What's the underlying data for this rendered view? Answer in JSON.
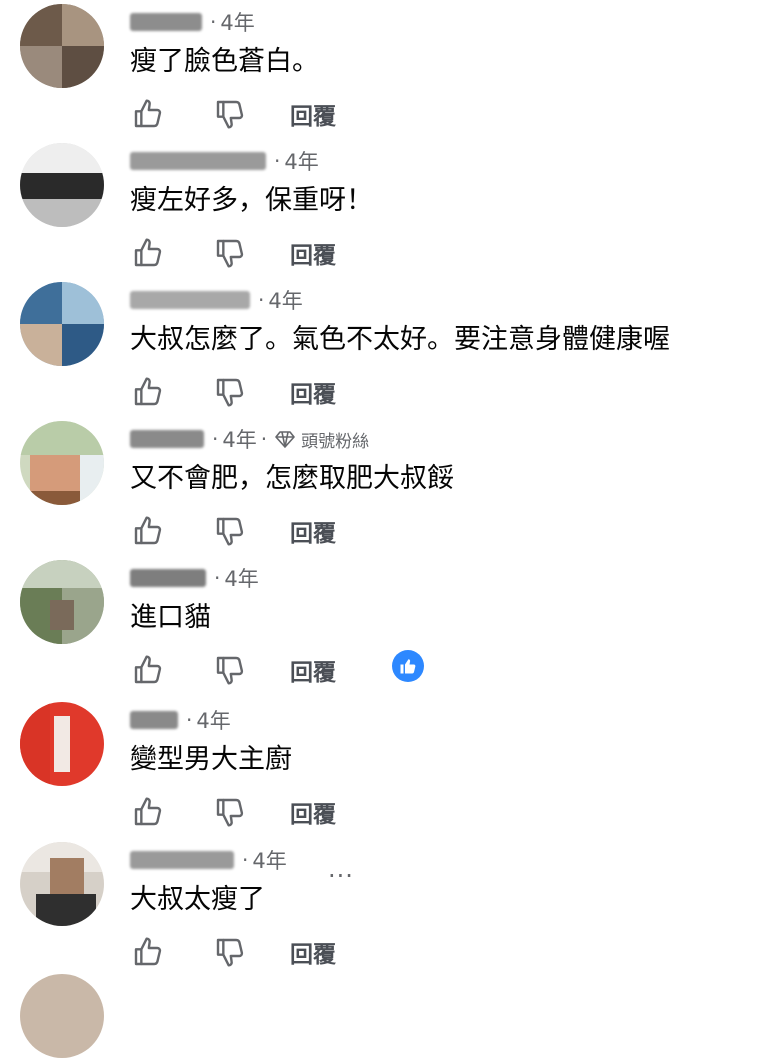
{
  "reply_label": "回覆",
  "comments": [
    {
      "time": "4年",
      "text": "瘦了臉色蒼白。"
    },
    {
      "time": "4年",
      "text": "瘦左好多，保重呀！"
    },
    {
      "time": "4年",
      "text": "大叔怎麼了。氣色不太好。要注意身體健康喔"
    },
    {
      "time": "4年",
      "text": "又不會肥，怎麼取肥大叔餒",
      "badge": "頭號粉絲"
    },
    {
      "time": "4年",
      "text": "進口貓"
    },
    {
      "time": "4年",
      "text": "變型男大主廚"
    },
    {
      "time": "4年",
      "text": "大叔太瘦了"
    }
  ],
  "more_label": "···",
  "colors": {
    "secondary_text": "#65676b",
    "reaction_blue": "#2d88ff"
  },
  "icons": [
    "thumbs-up-icon",
    "thumbs-down-icon",
    "diamond-icon",
    "like-reaction-icon",
    "more-options-icon"
  ]
}
